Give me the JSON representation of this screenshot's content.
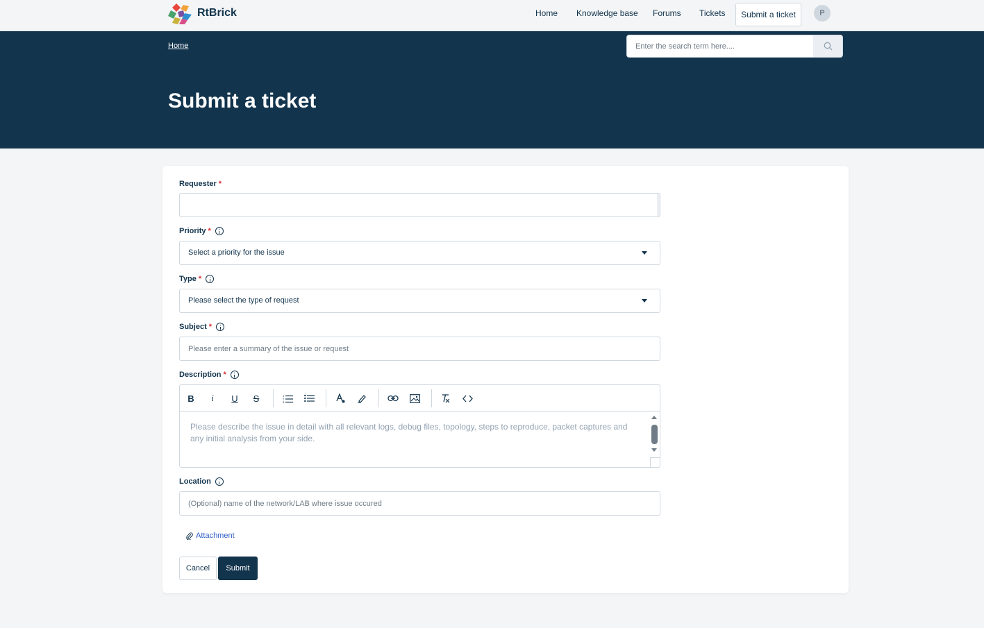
{
  "brand": {
    "name": "RtBrick"
  },
  "nav": {
    "home": "Home",
    "knowledge_base": "Knowledge base",
    "forums": "Forums",
    "tickets": "Tickets",
    "submit_ticket": "Submit a ticket",
    "avatar_initial": "P"
  },
  "banner": {
    "breadcrumb_home": "Home",
    "search_placeholder": "Enter the search term here....",
    "title": "Submit a ticket"
  },
  "form": {
    "requester": {
      "label": "Requester",
      "required": "*",
      "value": ""
    },
    "priority": {
      "label": "Priority",
      "required": "*",
      "selected": "Select a priority for the issue"
    },
    "type": {
      "label": "Type",
      "required": "*",
      "selected": "Please select the type of request"
    },
    "subject": {
      "label": "Subject",
      "required": "*",
      "placeholder": "Please enter a summary of the issue or request"
    },
    "description": {
      "label": "Description",
      "required": "*",
      "placeholder": "Please describe the issue in detail with all relevant logs, debug files, topology, steps to reproduce, packet captures and any initial analysis from your side."
    },
    "location": {
      "label": "Location",
      "placeholder": "(Optional) name of the network/LAB where issue occured"
    },
    "attachment": "Attachment",
    "cancel": "Cancel",
    "submit": "Submit"
  },
  "colors": {
    "primary": "#12344d",
    "required": "#d72d30",
    "link": "#2c5cc5",
    "background": "#f4f5f6"
  }
}
